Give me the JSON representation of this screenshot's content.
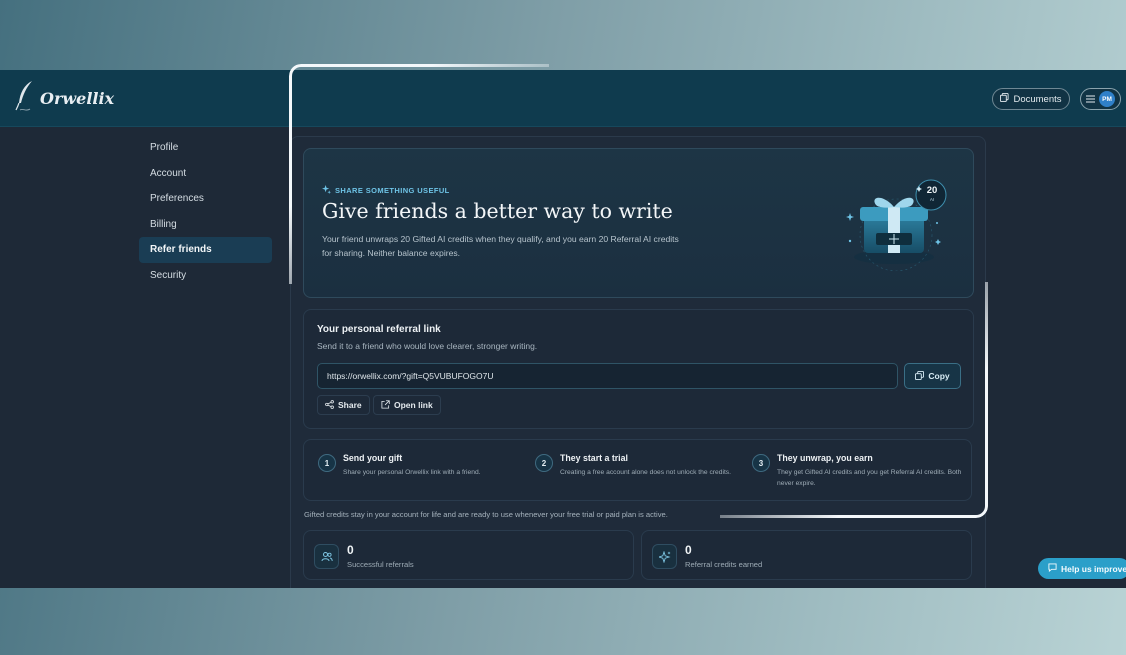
{
  "header": {
    "logo_text": "Orwellix",
    "documents_label": "Documents",
    "avatar_initials": "PM"
  },
  "sidebar": {
    "items": [
      {
        "label": "Profile",
        "active": false
      },
      {
        "label": "Account",
        "active": false
      },
      {
        "label": "Preferences",
        "active": false
      },
      {
        "label": "Billing",
        "active": false
      },
      {
        "label": "Refer friends",
        "active": true
      },
      {
        "label": "Security",
        "active": false
      }
    ]
  },
  "hero": {
    "eyebrow": "SHARE SOMETHING USEFUL",
    "title": "Give friends a better way to write",
    "description": "Your friend unwraps 20 Gifted AI credits when they qualify, and you earn 20 Referral AI credits for sharing. Neither balance expires.",
    "badge_value": "20",
    "badge_unit": "AI"
  },
  "referral": {
    "title": "Your personal referral link",
    "subtitle": "Send it to a friend who would love clearer, stronger writing.",
    "link_value": "https://orwellix.com/?gift=Q5VUBUFOGO7U",
    "copy_label": "Copy",
    "share_label": "Share",
    "open_label": "Open link"
  },
  "steps": [
    {
      "num": "1",
      "title": "Send your gift",
      "desc": "Share your personal Orwellix link with a friend."
    },
    {
      "num": "2",
      "title": "They start a trial",
      "desc": "Creating a free account alone does not unlock the credits."
    },
    {
      "num": "3",
      "title": "They unwrap, you earn",
      "desc": "They get Gifted AI credits and you get Referral AI credits. Both never expire."
    }
  ],
  "note": "Gifted credits stay in your account for life and are ready to use whenever your free trial or paid plan is active.",
  "stats": [
    {
      "value": "0",
      "label": "Successful referrals",
      "icon": "users-icon"
    },
    {
      "value": "0",
      "label": "Referral credits earned",
      "icon": "sparkles-icon"
    }
  ],
  "help_label": "Help us improve",
  "colors": {
    "accent": "#2b9fc9",
    "header_bg": "#0f3b4e",
    "app_bg": "#1e2937",
    "eyebrow": "#6ec3e6"
  }
}
